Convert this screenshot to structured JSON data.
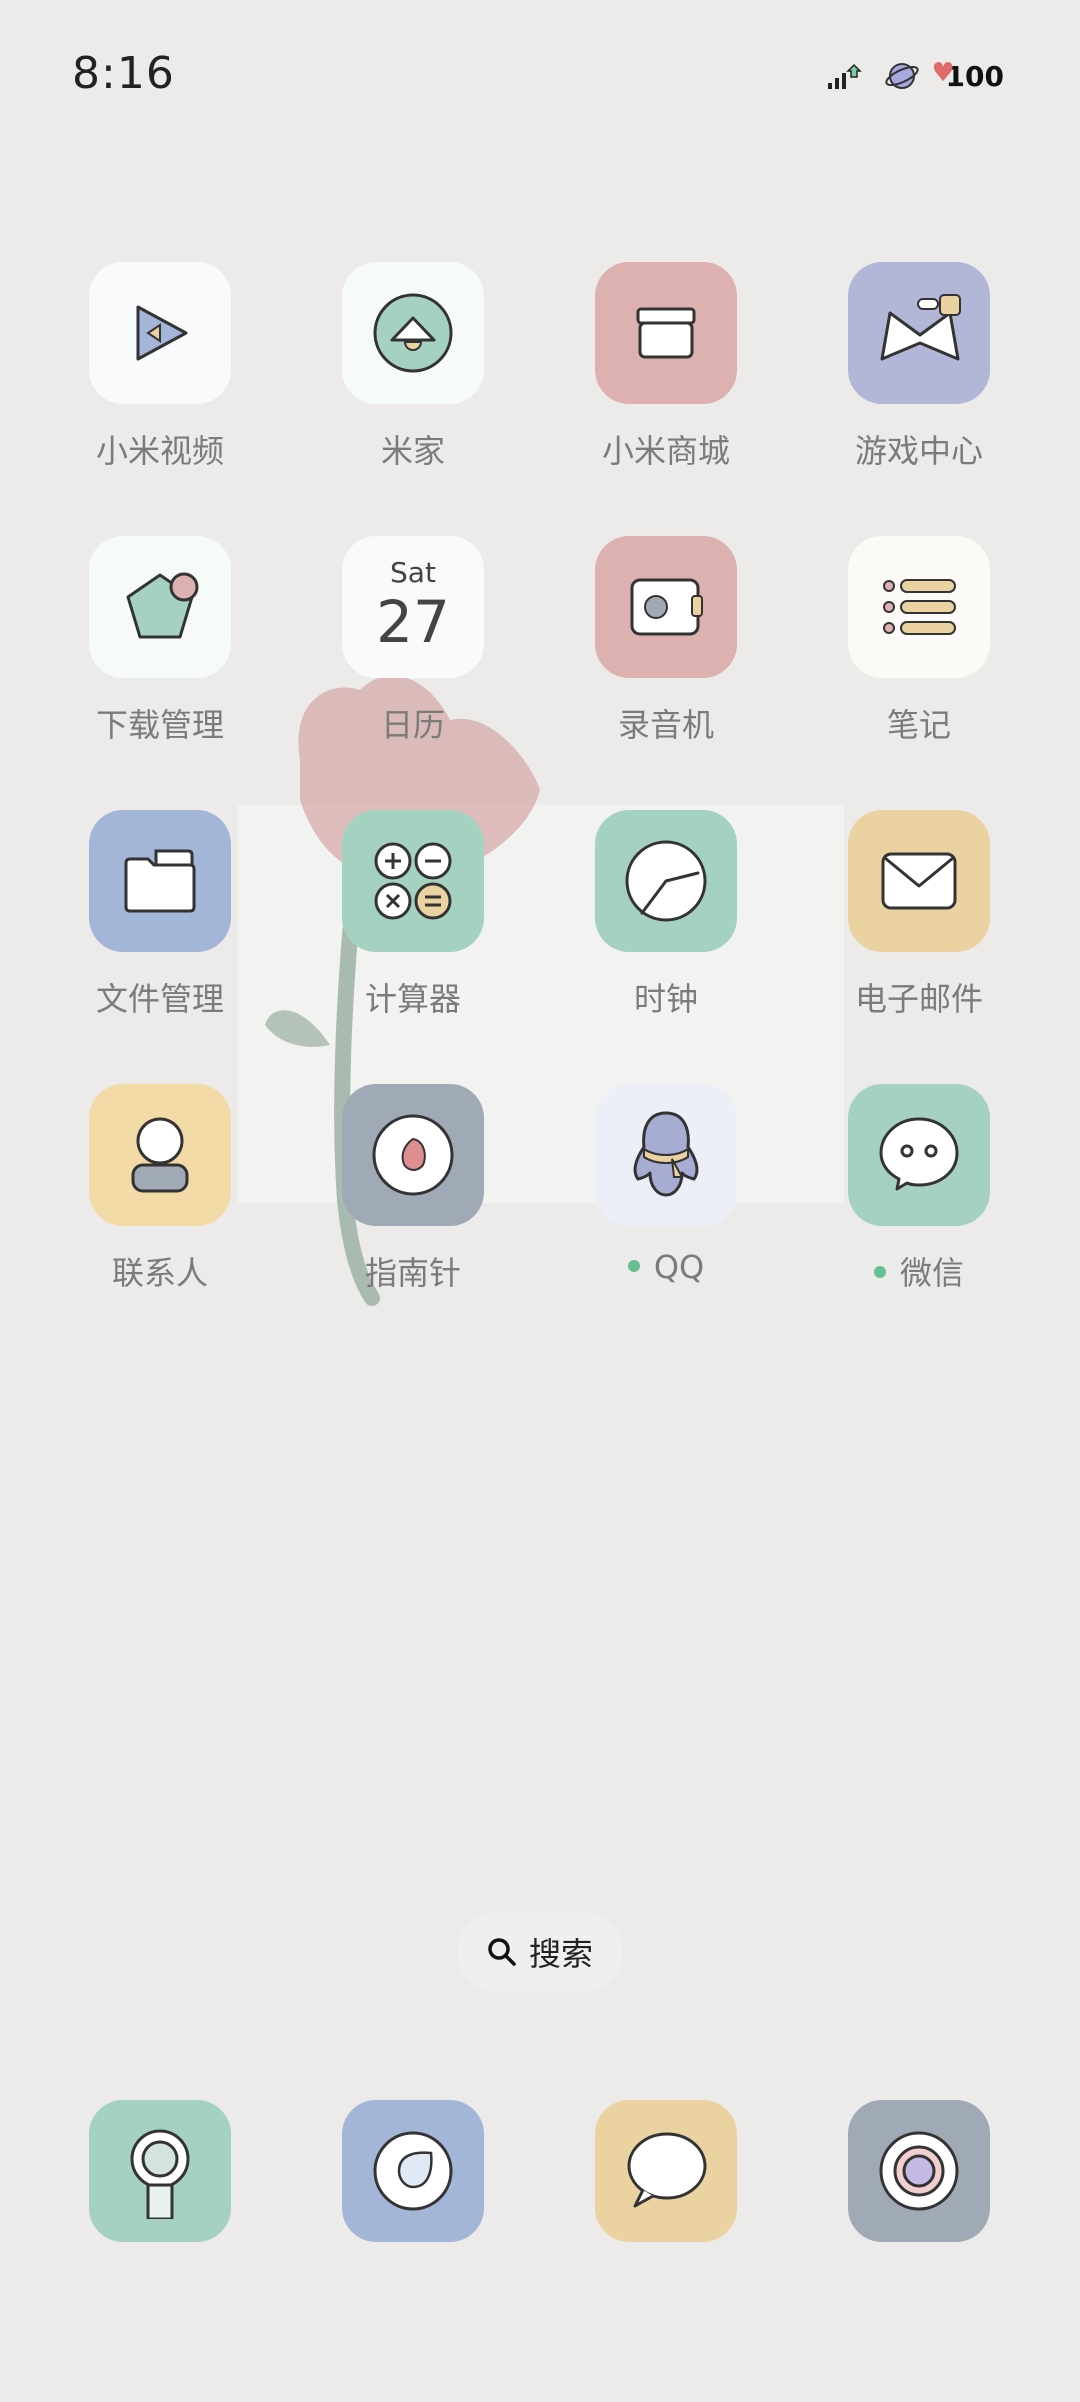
{
  "status_bar": {
    "time": "8:16",
    "battery": "100",
    "icons": [
      "signal-icon",
      "planet-icon",
      "battery-heart-icon"
    ]
  },
  "apps": [
    {
      "label": "小米视频",
      "icon": "play-icon",
      "color": "#f8fafb"
    },
    {
      "label": "米家",
      "icon": "home-lamp-icon",
      "color": "#f6fbf8"
    },
    {
      "label": "小米商城",
      "icon": "store-box-icon",
      "color": "#dcb1b0"
    },
    {
      "label": "游戏中心",
      "icon": "game-icon",
      "color": "#b2b7d8"
    },
    {
      "label": "下载管理",
      "icon": "download-pentagon-icon",
      "color": "#f6fbf8"
    },
    {
      "label": "日历",
      "icon": "calendar-icon",
      "color": "#fafafa",
      "day": "Sat",
      "date": "27"
    },
    {
      "label": "录音机",
      "icon": "recorder-icon",
      "color": "#dcb1b0"
    },
    {
      "label": "笔记",
      "icon": "notes-icon",
      "color": "#fbfaf7"
    },
    {
      "label": "文件管理",
      "icon": "folder-icon",
      "color": "#a3b6d8"
    },
    {
      "label": "计算器",
      "icon": "calculator-icon",
      "color": "#a5d2c0"
    },
    {
      "label": "时钟",
      "icon": "clock-icon",
      "color": "#a5d2c0"
    },
    {
      "label": "电子邮件",
      "icon": "mail-icon",
      "color": "#ead3a0"
    },
    {
      "label": "联系人",
      "icon": "contact-icon",
      "color": "#f2dba7"
    },
    {
      "label": "指南针",
      "icon": "compass-icon",
      "color": "#a0a9b6"
    },
    {
      "label": "QQ",
      "icon": "qq-penguin-icon",
      "color": "#eceff8"
    },
    {
      "label": "微信",
      "icon": "wechat-icon",
      "color": "#a5d2c0"
    }
  ],
  "search": {
    "label": "搜索"
  },
  "dock": [
    {
      "icon": "phone-icon",
      "color": "#a5d2c0"
    },
    {
      "icon": "browser-icon",
      "color": "#a3b6d8"
    },
    {
      "icon": "messages-icon",
      "color": "#ead3a0"
    },
    {
      "icon": "camera-icon",
      "color": "#a0a9b6"
    }
  ],
  "colors": {
    "background": "#ecebea",
    "flower": "#d7aeae",
    "stem": "#a9bab0",
    "notification_dot": "#63c08e"
  }
}
